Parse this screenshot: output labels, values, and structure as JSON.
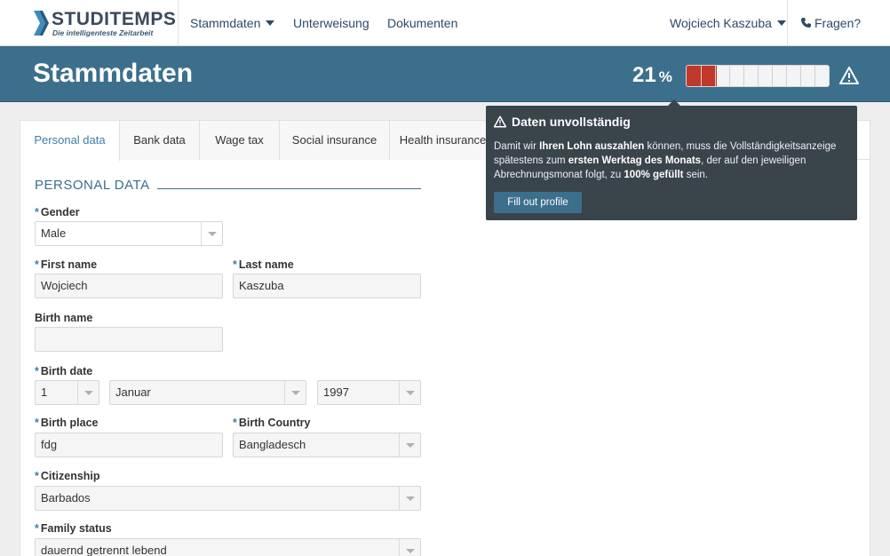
{
  "brand": {
    "name": "STUDITEMPS",
    "tagline": "Die intelligenteste Zeitarbeit"
  },
  "nav": {
    "items": [
      {
        "label": "Stammdaten",
        "has_dropdown": true
      },
      {
        "label": "Unterweisung"
      },
      {
        "label": "Dokumenten"
      }
    ],
    "user": {
      "label": "Wojciech Kaszuba",
      "has_dropdown": true
    },
    "help": {
      "label": "Fragen?",
      "icon": "phone-icon"
    }
  },
  "header": {
    "title": "Stammdaten",
    "progress": {
      "percent_value": "21",
      "percent_symbol": "%",
      "fraction": 0.21,
      "segments": 10,
      "fill_color": "#c0392b"
    },
    "warning_icon": "warning-icon"
  },
  "tooltip": {
    "title": "Daten unvollständig",
    "body": {
      "t1": "Damit wir ",
      "b1": "Ihren Lohn auszahlen",
      "t2": " können, muss die Vollständigkeitsanzeige spätestens zum ",
      "b2": "ersten Werktag des Monats",
      "t3": ", der auf den jeweiligen Abrechnungsmonat folgt, zu ",
      "b3": "100% gefüllt",
      "t4": " sein."
    },
    "button": "Fill out profile"
  },
  "tabs": [
    {
      "label": "Personal data",
      "active": true
    },
    {
      "label": "Bank data"
    },
    {
      "label": "Wage tax"
    },
    {
      "label": "Social insurance"
    },
    {
      "label": "Health insurance"
    }
  ],
  "form": {
    "section_title": "PERSONAL DATA",
    "required_mark": "*",
    "gender": {
      "label": "Gender",
      "value": "Male"
    },
    "first_name": {
      "label": "First name",
      "value": "Wojciech"
    },
    "last_name": {
      "label": "Last name",
      "value": "Kaszuba"
    },
    "birth_name": {
      "label": "Birth name",
      "value": ""
    },
    "birth_date": {
      "label": "Birth date",
      "day": "1",
      "month": "Januar",
      "year": "1997"
    },
    "birth_place": {
      "label": "Birth place",
      "value": "fdg"
    },
    "birth_country": {
      "label": "Birth Country",
      "value": "Bangladesch"
    },
    "citizenship": {
      "label": "Citizenship",
      "value": "Barbados"
    },
    "family_status": {
      "label": "Family status",
      "value": "dauernd getrennt lebend"
    }
  },
  "colors": {
    "accent": "#3c6f8c",
    "link": "#2d4a66",
    "progress_fill": "#c0392b",
    "tooltip_bg": "#3a444b"
  }
}
